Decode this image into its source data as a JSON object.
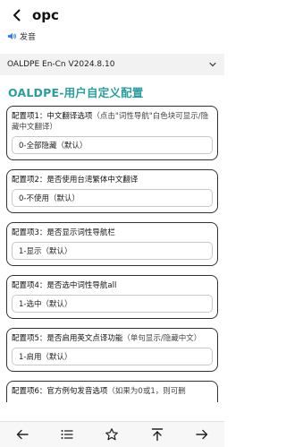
{
  "header": {
    "word": "opc",
    "audio_label": "发音"
  },
  "dictionary": {
    "name": "OALDPE En-Cn V2024.8.10"
  },
  "section_title": "OALDPE-用户自定义配置",
  "cards": [
    {
      "label_main": "配置项1：中文翻译选项",
      "label_hint": "（点击\"词性导航\"白色块可显示/隐藏中文翻译）",
      "value": "0-全部隐藏（默认）"
    },
    {
      "label_main": "配置项2：是否使用台湾繁体中文翻译",
      "label_hint": "",
      "value": "0-不使用（默认）"
    },
    {
      "label_main": "配置项3：是否显示词性导航栏",
      "label_hint": "",
      "value": "1-显示（默认）"
    },
    {
      "label_main": "配置项4：是否选中词性导航all",
      "label_hint": "",
      "value": "1-选中（默认）"
    },
    {
      "label_main": "配置项5：是否启用英文点译功能",
      "label_hint": "（单句显示/隐藏中文）",
      "value": "1-启用（默认）"
    },
    {
      "label_main": "配置项6：官方例句发音选项",
      "label_hint": "（如果为0或1，则可删",
      "value": ""
    }
  ],
  "nav": {
    "icons": [
      "arrow-left-icon",
      "list-icon",
      "star-icon",
      "arrow-up-to-top-icon",
      "arrow-right-icon"
    ]
  },
  "colors": {
    "accent": "#2a9d9f",
    "speaker": "#2a7de1"
  }
}
